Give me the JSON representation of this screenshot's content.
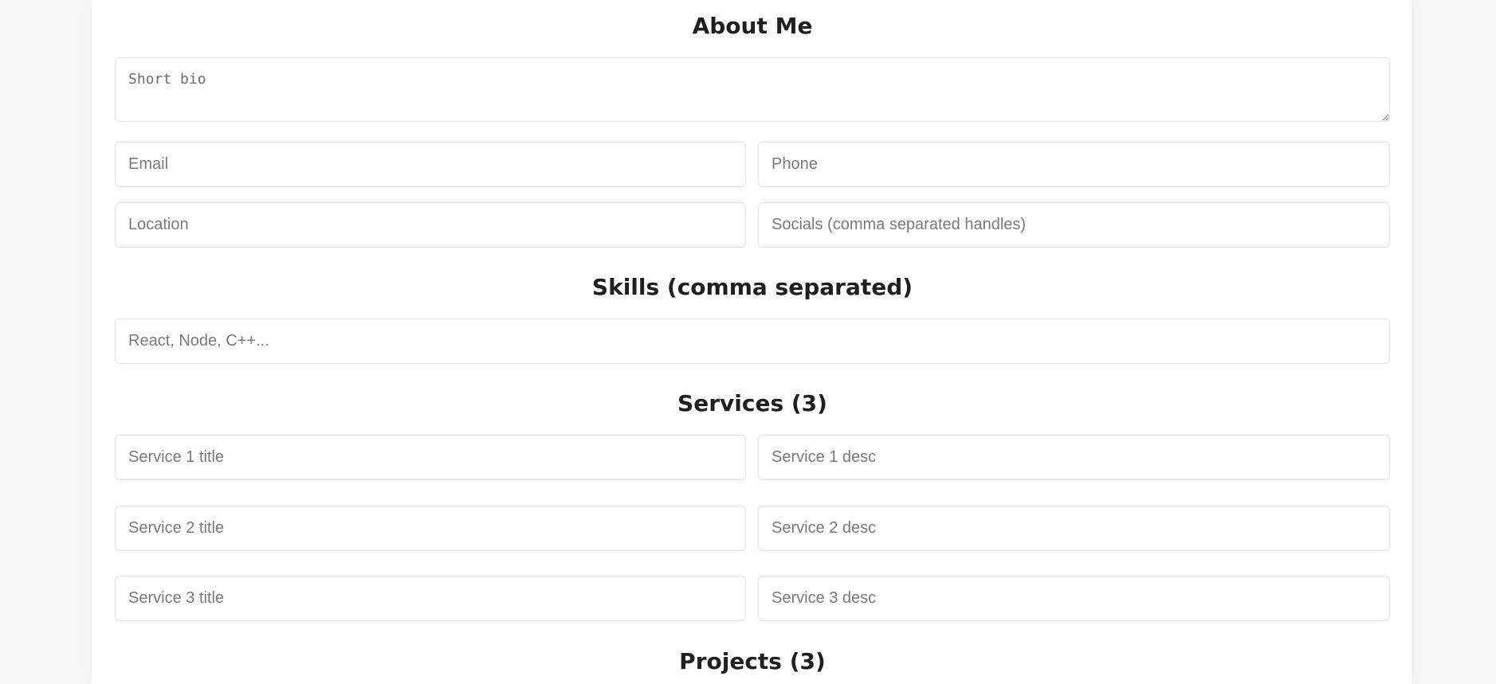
{
  "about": {
    "heading": "About Me",
    "bio_placeholder": "Short bio",
    "email_placeholder": "Email",
    "phone_placeholder": "Phone",
    "location_placeholder": "Location",
    "socials_placeholder": "Socials (comma separated handles)"
  },
  "skills": {
    "heading": "Skills (comma separated)",
    "placeholder": "React, Node, C++..."
  },
  "services": {
    "heading": "Services (3)",
    "items": [
      {
        "title_placeholder": "Service 1 title",
        "desc_placeholder": "Service 1 desc"
      },
      {
        "title_placeholder": "Service 2 title",
        "desc_placeholder": "Service 2 desc"
      },
      {
        "title_placeholder": "Service 3 title",
        "desc_placeholder": "Service 3 desc"
      }
    ]
  },
  "projects": {
    "heading": "Projects (3)"
  }
}
